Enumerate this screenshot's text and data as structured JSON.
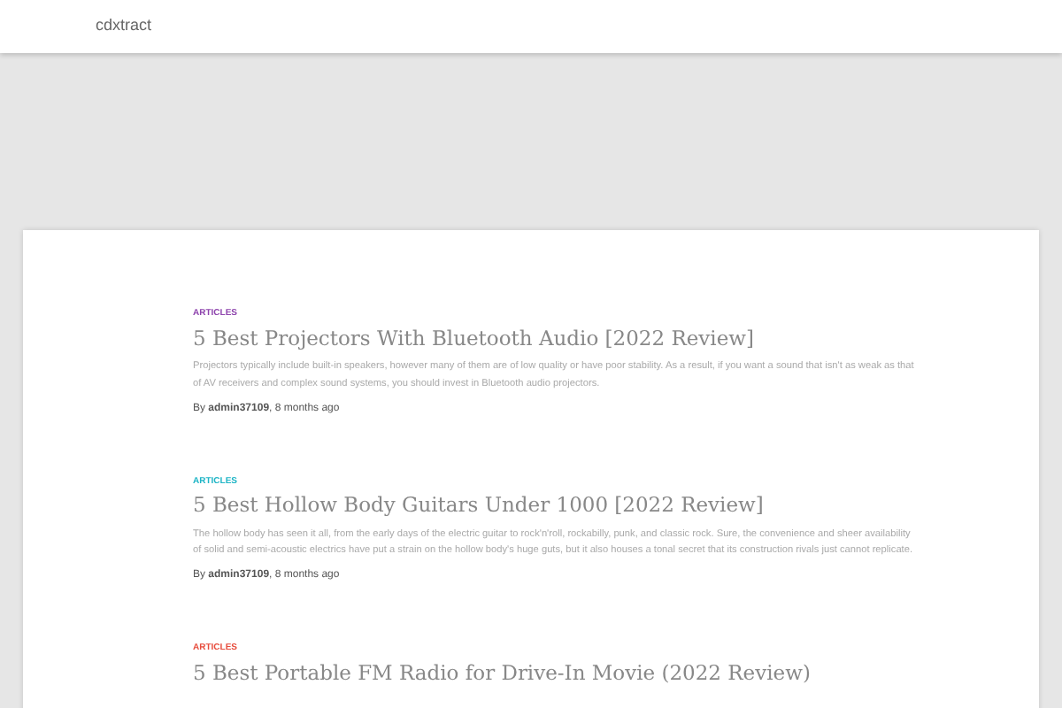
{
  "site": {
    "brand": "cdxtract"
  },
  "posts": [
    {
      "category": "ARTICLES",
      "color": "#8e44ad",
      "title": "5 Best Projectors With Bluetooth Audio [2022 Review]",
      "excerpt": "Projectors typically include built-in speakers, however many of them are of low quality or have poor stability. As a result, if you want a sound that isn't as weak as that of AV receivers and complex sound systems, you should invest in Bluetooth audio projectors.",
      "byline": "By **admin37109**, 8 months ago"
    },
    {
      "category": "ARTICLES",
      "color": "#1fb5c6",
      "title": "5 Best Hollow Body Guitars Under 1000 [2022 Review]",
      "excerpt": "The hollow body has seen it all, from the early days of the electric guitar to rock'n'roll, rockabilly, punk, and classic rock. Sure, the convenience and sheer availability of solid and semi-acoustic electrics have put a strain on the hollow body's huge guts, but it also houses a tonal secret that its construction rivals just cannot replicate.",
      "byline": "By **admin37109**, 8 months ago"
    },
    {
      "category": "ARTICLES",
      "color": "#e74c3c",
      "title": "5 Best Portable FM Radio for Drive-In Movie (2022 Review)"
    }
  ]
}
